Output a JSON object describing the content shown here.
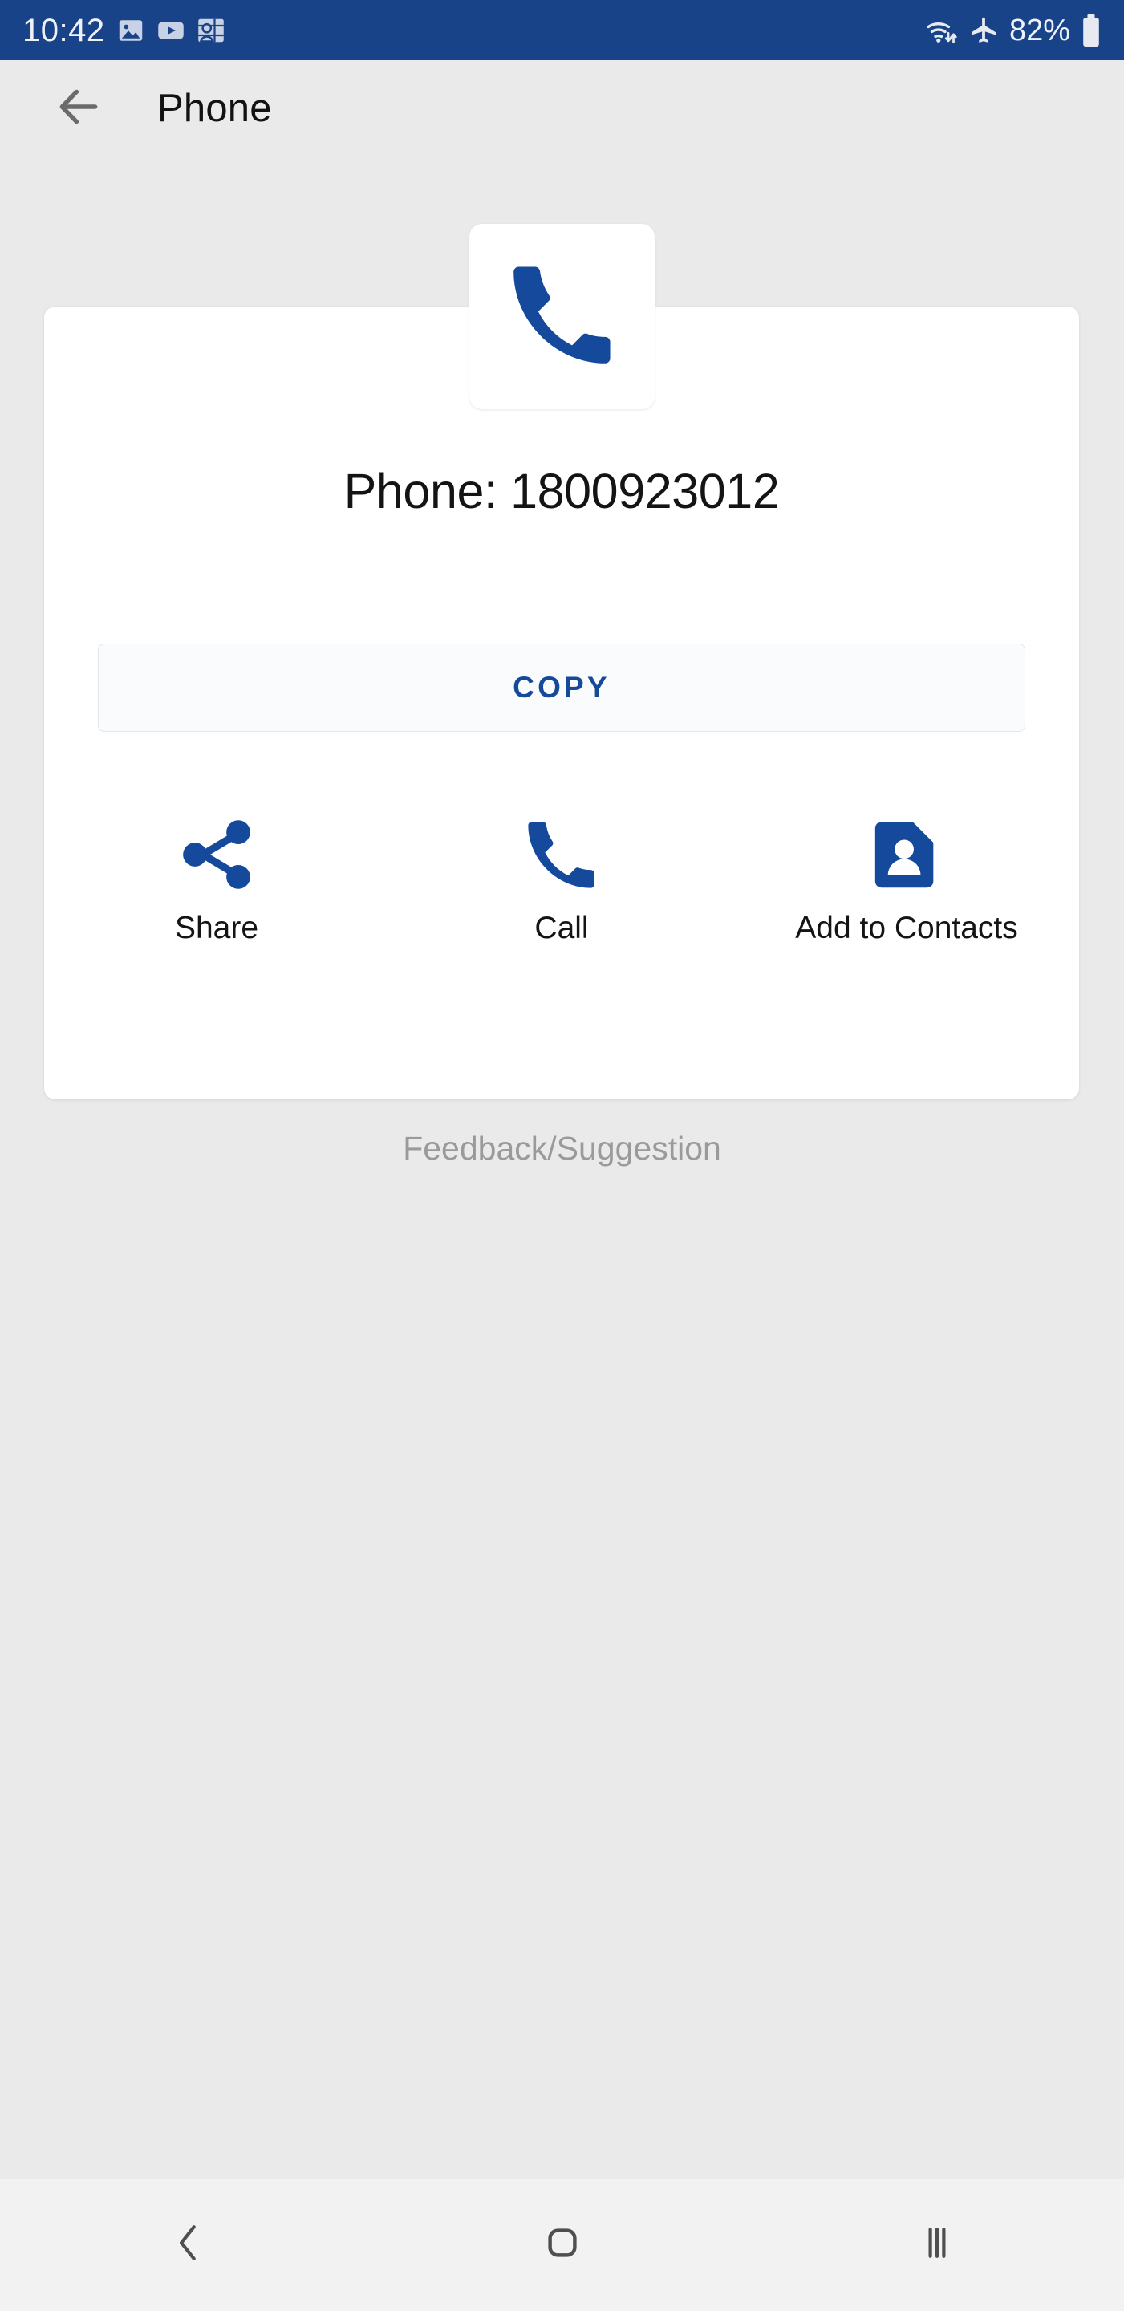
{
  "statusbar": {
    "clock": "10:42",
    "notification_icons": [
      "gallery-image-icon",
      "video-play-icon",
      "contacts-people-icon"
    ],
    "wifi_icon": "wifi-data-transfer-icon",
    "airplane_icon": "airplane-mode-icon",
    "battery_percent": "82%",
    "battery_icon": "battery-icon",
    "background_color": "#184389"
  },
  "appbar": {
    "back_icon": "back-arrow-icon",
    "title": "Phone"
  },
  "app_tile": {
    "icon": "phone-handset-icon",
    "icon_color": "#14499b"
  },
  "card": {
    "phone_label": "Phone: 1800923012",
    "copy_label": "COPY",
    "copy_text_color": "#15499a",
    "actions": [
      {
        "icon": "share-icon",
        "label": "Share"
      },
      {
        "icon": "call-phone-icon",
        "label": "Call"
      },
      {
        "icon": "add-contact-icon",
        "label": "Add to Contacts"
      }
    ]
  },
  "feedback": {
    "label": "Feedback/Suggestion"
  },
  "navbar": {
    "back_icon": "nav-back-chevron-icon",
    "home_icon": "nav-home-icon",
    "recents_icon": "nav-recents-icon"
  }
}
